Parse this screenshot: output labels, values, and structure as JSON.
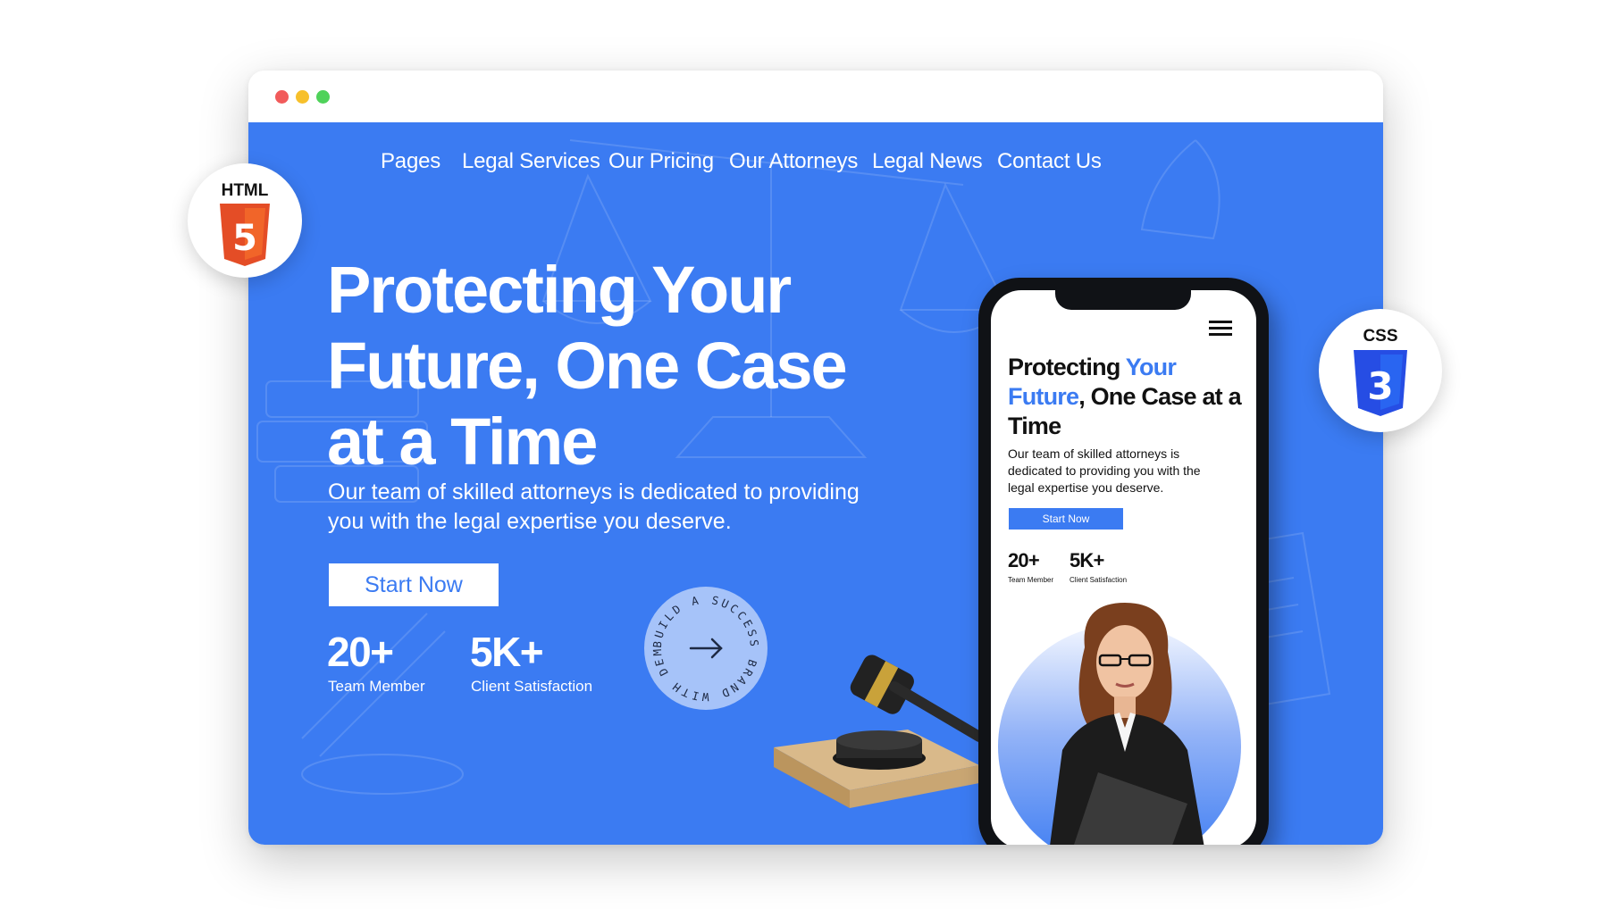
{
  "window": {
    "controls": [
      "close",
      "minimize",
      "maximize"
    ]
  },
  "nav": {
    "items": [
      "Pages",
      "Legal Services",
      "Our Pricing",
      "Our Attorneys",
      "Legal News",
      "Contact Us"
    ]
  },
  "hero": {
    "headline": "Protecting Your Future, One Case at a Time",
    "subtitle": "Our team of skilled attorneys is dedicated to providing you with the legal expertise you deserve.",
    "cta": "Start Now",
    "stats": [
      {
        "value": "20+",
        "label": "Team Member"
      },
      {
        "value": "5K+",
        "label": "Client Satisfaction"
      }
    ],
    "badge": {
      "ring_text": "BUILD A SUCCESS BRAND WITH DEMO!",
      "icon": "arrow-right-icon"
    }
  },
  "mobile": {
    "headline_part1": "Protecting ",
    "headline_part2": "Your",
    "headline_part3": "Future",
    "headline_part4": ", One Case at a Time",
    "subtitle": "Our team of skilled attorneys is dedicated to providing you with the legal expertise you deserve.",
    "cta": "Start Now",
    "stats": [
      {
        "value": "20+",
        "label": "Team Member"
      },
      {
        "value": "5K+",
        "label": "Client Satisfaction"
      }
    ],
    "menu_icon": "hamburger-icon"
  },
  "tech_badges": [
    {
      "label": "HTML",
      "icon": "html5-icon",
      "digit": "5"
    },
    {
      "label": "CSS",
      "icon": "css3-icon",
      "digit": "3"
    }
  ],
  "colors": {
    "brand_blue": "#3b7bf2",
    "html_orange": "#e44d26",
    "css_blue": "#264de4",
    "close": "#f15b5b",
    "minimize": "#f7c02b",
    "maximize": "#4fd25a"
  }
}
